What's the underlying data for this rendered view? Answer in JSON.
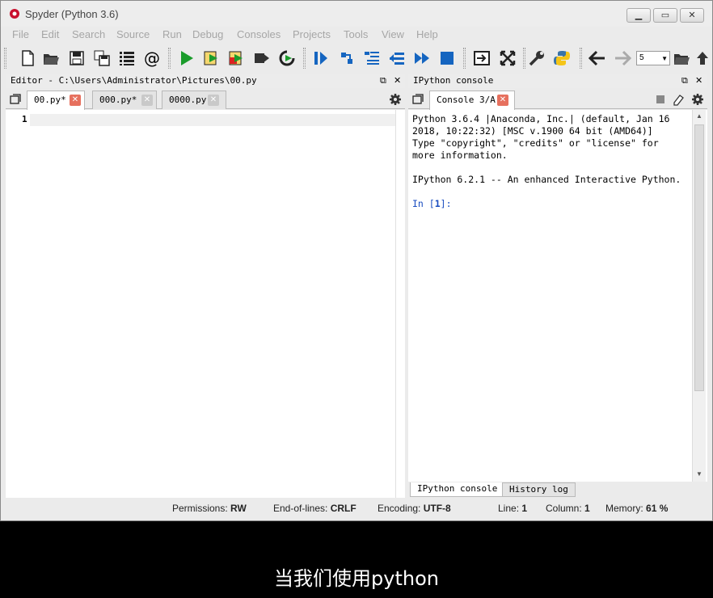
{
  "window": {
    "title": "Spyder (Python 3.6)"
  },
  "menu": [
    "File",
    "Edit",
    "Search",
    "Source",
    "Run",
    "Debug",
    "Consoles",
    "Projects",
    "Tools",
    "View",
    "Help"
  ],
  "toolbar": {
    "combo_value": "5"
  },
  "editor": {
    "header": "Editor - C:\\Users\\Administrator\\Pictures\\00.py",
    "tabs": [
      {
        "label": "00.py*",
        "active": true
      },
      {
        "label": "000.py*",
        "active": false
      },
      {
        "label": "0000.py",
        "active": false
      }
    ],
    "line_number": "1"
  },
  "console": {
    "header": "IPython console",
    "tab": "Console 3/A",
    "lines": [
      "Python 3.6.4 |Anaconda, Inc.| (default, Jan 16",
      "2018, 10:22:32) [MSC v.1900 64 bit (AMD64)]",
      "Type \"copyright\", \"credits\" or \"license\" for",
      "more information.",
      "",
      "IPython 6.2.1 -- An enhanced Interactive Python."
    ],
    "prompt": {
      "prefix": "In [",
      "number": "1",
      "suffix": "]:"
    },
    "bottom_tabs": [
      "IPython console",
      "History log"
    ]
  },
  "status": {
    "permissions_label": "Permissions:",
    "permissions_value": "RW",
    "eol_label": "End-of-lines:",
    "eol_value": "CRLF",
    "encoding_label": "Encoding:",
    "encoding_value": "UTF-8",
    "line_label": "Line:",
    "line_value": "1",
    "column_label": "Column:",
    "column_value": "1",
    "memory_label": "Memory:",
    "memory_value": "61 %"
  },
  "subtitle": "当我们使用python"
}
